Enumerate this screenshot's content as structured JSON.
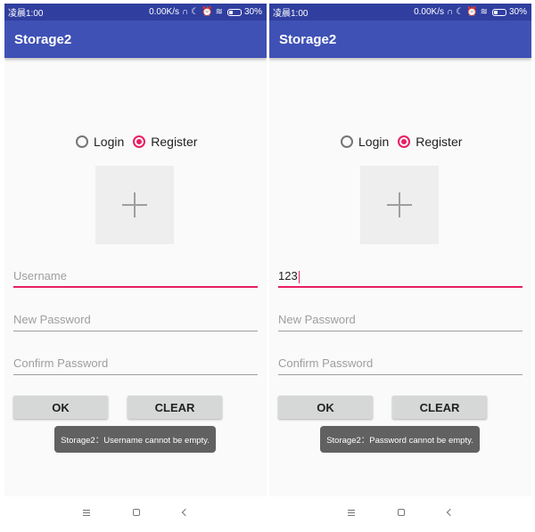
{
  "status_bar": {
    "time": "凌晨1:00",
    "network_speed": "0.00K/s",
    "icons": [
      "headphones-icon",
      "moon-icon",
      "alarm-icon",
      "wifi-icon",
      "battery-icon"
    ],
    "battery": "30%"
  },
  "colors": {
    "status_bar": "#303f9f",
    "app_bar": "#3f51b5",
    "accent": "#e91e63",
    "button": "#d6d7d7",
    "toast": "#616161"
  },
  "screens": [
    {
      "app_title": "Storage2",
      "radio": {
        "login_label": "Login",
        "register_label": "Register",
        "selected": "Register"
      },
      "image_picker_icon": "plus-icon",
      "username": {
        "value": "",
        "placeholder": "Username"
      },
      "new_password": {
        "value": "",
        "placeholder": "New Password"
      },
      "confirm_password": {
        "value": "",
        "placeholder": "Confirm Password"
      },
      "ok_label": "OK",
      "clear_label": "CLEAR",
      "toast": "Storage2：Username cannot be empty."
    },
    {
      "app_title": "Storage2",
      "radio": {
        "login_label": "Login",
        "register_label": "Register",
        "selected": "Register"
      },
      "image_picker_icon": "plus-icon",
      "username": {
        "value": "123",
        "placeholder": "Username"
      },
      "new_password": {
        "value": "",
        "placeholder": "New Password"
      },
      "confirm_password": {
        "value": "",
        "placeholder": "Confirm Password"
      },
      "ok_label": "OK",
      "clear_label": "CLEAR",
      "toast": "Storage2：Password cannot be empty."
    }
  ],
  "navigation_bar": {
    "icons": [
      "menu-icon",
      "home-icon",
      "back-icon"
    ]
  }
}
